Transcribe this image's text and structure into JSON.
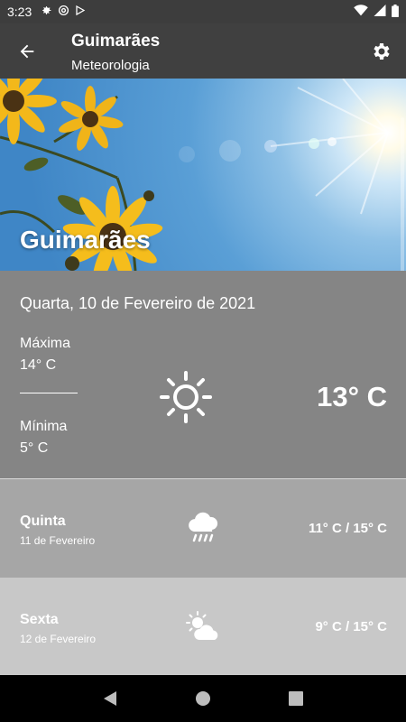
{
  "status": {
    "time": "3:23"
  },
  "app_bar": {
    "title": "Guimarães",
    "subtitle": "Meteorologia"
  },
  "hero": {
    "city": "Guimarães"
  },
  "today": {
    "date": "Quarta, 10 de Fevereiro de 2021",
    "max_label": "Máxima",
    "max_value": "14° C",
    "min_label": "Mínima",
    "min_value": "5° C",
    "current_temp": "13° C",
    "icon": "sun-icon"
  },
  "forecast": [
    {
      "day": "Quinta",
      "date": "11 de Fevereiro",
      "temps": "11° C / 15° C",
      "icon": "rain-cloud-icon",
      "bg": "#a6a6a6"
    },
    {
      "day": "Sexta",
      "date": "12 de Fevereiro",
      "temps": "9° C / 15° C",
      "icon": "partly-cloudy-icon",
      "bg": "#c8c8c8"
    }
  ]
}
